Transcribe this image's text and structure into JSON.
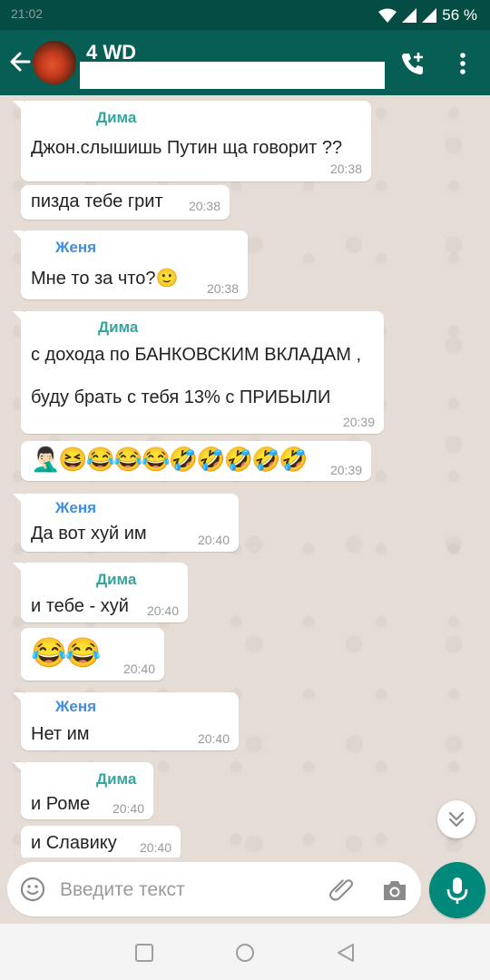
{
  "status_bar": {
    "time": "21:02",
    "battery": "56 %"
  },
  "header": {
    "title": "4 WD"
  },
  "messages": [
    {
      "sender": "Дима",
      "lines": [
        "Джон.слышишь Путин ща говорит ??"
      ],
      "time": "20:38"
    },
    {
      "sender": "",
      "lines": [
        "пизда тебе грит"
      ],
      "time": "20:38"
    },
    {
      "sender": "Женя",
      "lines": [
        "Мне то за что?🙂"
      ],
      "time": "20:38"
    },
    {
      "sender": "Дима",
      "lines": [
        "с дохода по БАНКОВСКИМ ВКЛАДАМ ,",
        "буду брать с тебя 13% с ПРИБЫЛИ"
      ],
      "time": "20:39"
    },
    {
      "sender": "",
      "lines": [
        "🤦🏻‍♂️😆😂😂😂🤣🤣🤣🤣🤣"
      ],
      "time": "20:39"
    },
    {
      "sender": "Женя",
      "lines": [
        "Да вот хуй им"
      ],
      "time": "20:40"
    },
    {
      "sender": "Дима",
      "lines": [
        "и тебе - хуй"
      ],
      "time": "20:40"
    },
    {
      "sender": "",
      "lines": [
        "😂😂"
      ],
      "time": "20:40"
    },
    {
      "sender": "Женя",
      "lines": [
        "Нет им"
      ],
      "time": "20:40"
    },
    {
      "sender": "Дима",
      "lines": [
        "и Роме"
      ],
      "time": "20:40"
    },
    {
      "sender": "",
      "lines": [
        "и Славику"
      ],
      "time": "20:40"
    }
  ],
  "composer": {
    "placeholder": "Введите текст"
  },
  "colors": {
    "header": "#075e54",
    "status_bar": "#054d44",
    "accent": "#00897b",
    "chat_bg": "#e5ddd5"
  },
  "icons": [
    "back-arrow-icon",
    "add-call-icon",
    "more-vert-icon",
    "emoji-icon",
    "attach-icon",
    "camera-icon",
    "mic-icon",
    "chevron-down-icon"
  ]
}
